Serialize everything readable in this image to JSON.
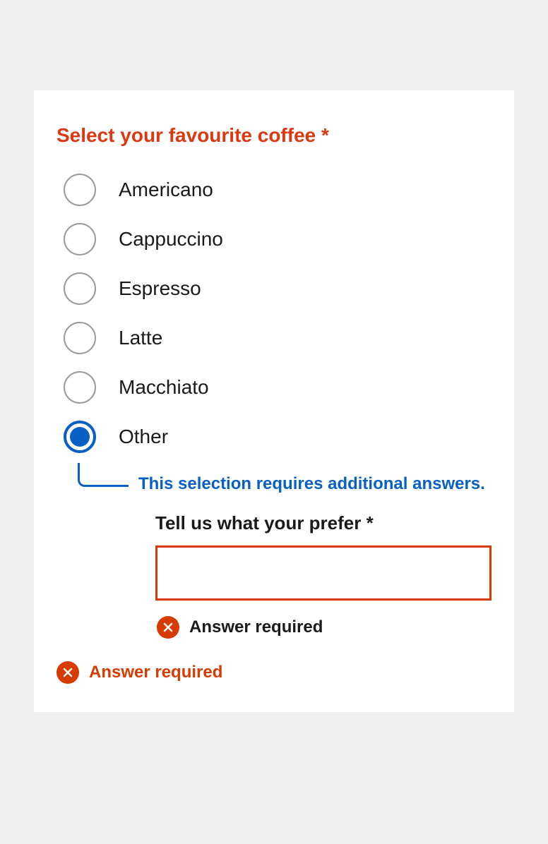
{
  "question": {
    "title": "Select your favourite coffee *",
    "options": [
      {
        "label": "Americano",
        "selected": false
      },
      {
        "label": "Cappuccino",
        "selected": false
      },
      {
        "label": "Espresso",
        "selected": false
      },
      {
        "label": "Latte",
        "selected": false
      },
      {
        "label": "Macchiato",
        "selected": false
      },
      {
        "label": "Other",
        "selected": true
      }
    ],
    "subInfo": "This selection requires additional answers.",
    "subQuestion": {
      "label": "Tell us what your prefer *",
      "value": "",
      "error": "Answer required"
    },
    "error": "Answer required"
  }
}
